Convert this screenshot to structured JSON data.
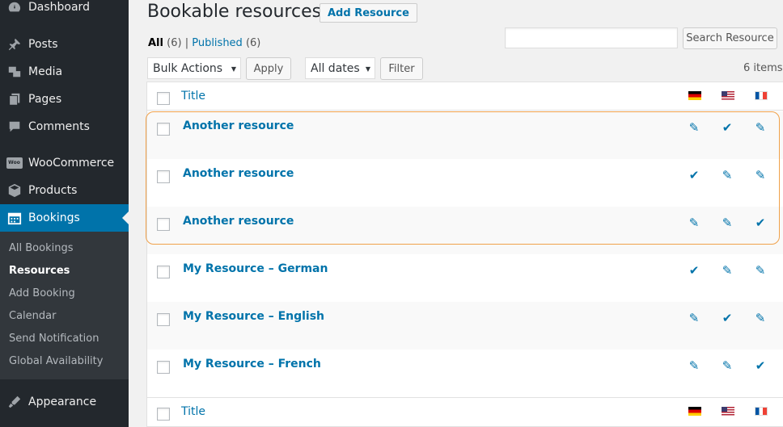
{
  "sidebar": {
    "menu": [
      {
        "label": "Dashboard",
        "icon": "dashboard-icon"
      },
      {
        "label": "Posts",
        "icon": "pin-icon"
      },
      {
        "label": "Media",
        "icon": "media-icon"
      },
      {
        "label": "Pages",
        "icon": "pages-icon"
      },
      {
        "label": "Comments",
        "icon": "comments-icon"
      },
      {
        "label": "WooCommerce",
        "icon": "woocommerce-icon",
        "badge": "Woo"
      },
      {
        "label": "Products",
        "icon": "products-icon"
      },
      {
        "label": "Bookings",
        "icon": "calendar-icon"
      },
      {
        "label": "Appearance",
        "icon": "brush-icon"
      }
    ],
    "submenu": [
      "All Bookings",
      "Resources",
      "Add Booking",
      "Calendar",
      "Send Notification",
      "Global Availability"
    ]
  },
  "header": {
    "title": "Bookable resources",
    "add_label": "Add Resource"
  },
  "views": {
    "all_label": "All",
    "all_count": "(6)",
    "separator": "|",
    "published_label": "Published",
    "published_count": "(6)"
  },
  "search": {
    "value": "",
    "button_label": "Search Resource"
  },
  "toolbar": {
    "bulk_selected": "Bulk Actions",
    "apply_label": "Apply",
    "dates_selected": "All dates",
    "filter_label": "Filter",
    "items_count": "6 items"
  },
  "table": {
    "header_title": "Title",
    "languages": [
      {
        "name": "German",
        "flag": "flag-de-icon"
      },
      {
        "name": "English",
        "flag": "flag-us-icon"
      },
      {
        "name": "French",
        "flag": "flag-fr-icon"
      }
    ],
    "rows": [
      {
        "title": "Another resource",
        "status": [
          "edit",
          "check",
          "edit"
        ]
      },
      {
        "title": "Another resource",
        "status": [
          "check",
          "edit",
          "edit"
        ]
      },
      {
        "title": "Another resource",
        "status": [
          "edit",
          "edit",
          "check"
        ]
      },
      {
        "title": "My Resource – German",
        "status": [
          "check",
          "edit",
          "edit"
        ]
      },
      {
        "title": "My Resource – English",
        "status": [
          "edit",
          "check",
          "edit"
        ]
      },
      {
        "title": "My Resource – French",
        "status": [
          "edit",
          "edit",
          "check"
        ]
      }
    ],
    "footer_title": "Title"
  },
  "colors": {
    "accent": "#0073aa",
    "sidebar_bg": "#23282d",
    "highlight": "#f0a14a"
  }
}
